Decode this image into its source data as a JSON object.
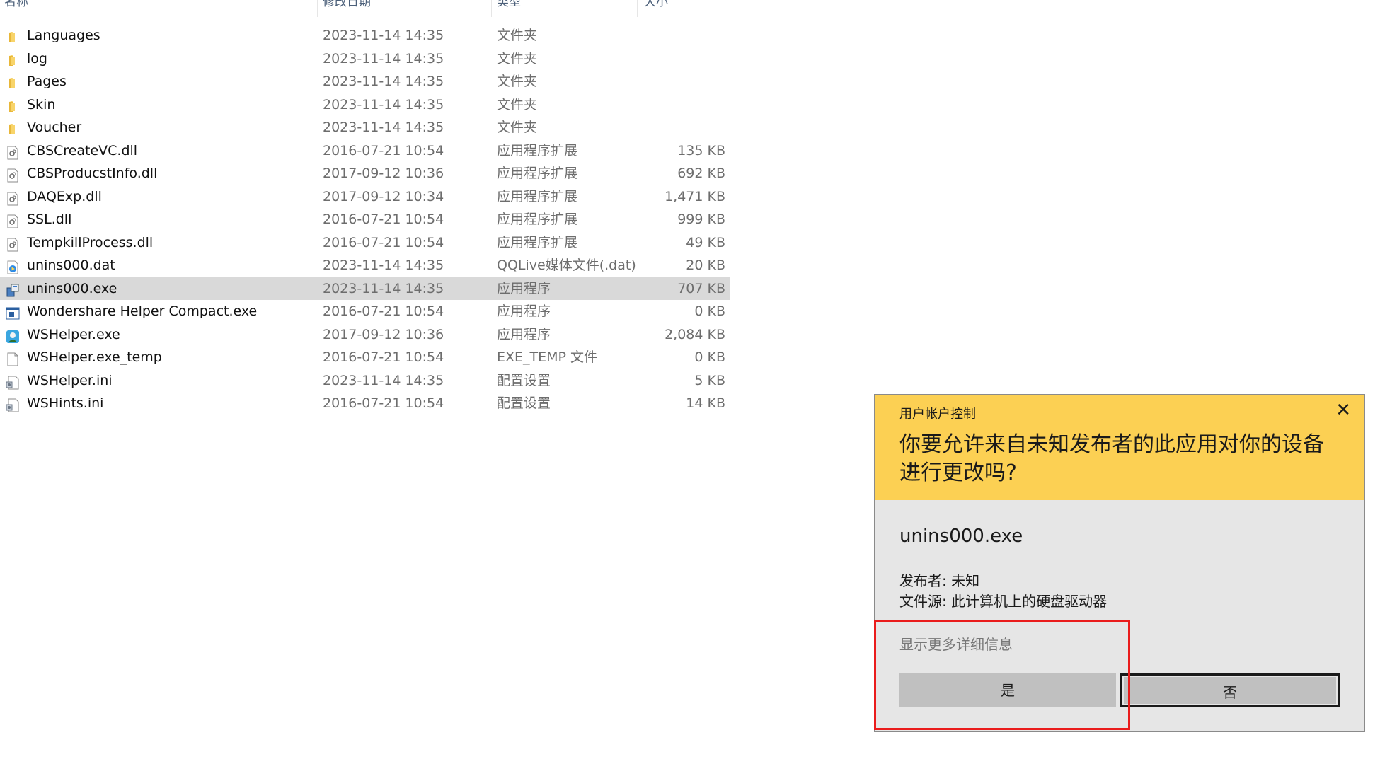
{
  "columns": {
    "name": "名称",
    "date": "修改日期",
    "type": "类型",
    "size": "大小"
  },
  "files": [
    {
      "icon": "folder-icon",
      "name": "Languages",
      "date": "2023-11-14 14:35",
      "type": "文件夹",
      "size": ""
    },
    {
      "icon": "folder-icon",
      "name": "log",
      "date": "2023-11-14 14:35",
      "type": "文件夹",
      "size": ""
    },
    {
      "icon": "folder-icon",
      "name": "Pages",
      "date": "2023-11-14 14:35",
      "type": "文件夹",
      "size": ""
    },
    {
      "icon": "folder-icon",
      "name": "Skin",
      "date": "2023-11-14 14:35",
      "type": "文件夹",
      "size": ""
    },
    {
      "icon": "folder-icon",
      "name": "Voucher",
      "date": "2023-11-14 14:35",
      "type": "文件夹",
      "size": ""
    },
    {
      "icon": "dll-file-icon",
      "name": "CBSCreateVC.dll",
      "date": "2016-07-21 10:54",
      "type": "应用程序扩展",
      "size": "135 KB"
    },
    {
      "icon": "dll-file-icon",
      "name": "CBSProducstInfo.dll",
      "date": "2017-09-12 10:36",
      "type": "应用程序扩展",
      "size": "692 KB"
    },
    {
      "icon": "dll-file-icon",
      "name": "DAQExp.dll",
      "date": "2017-09-12 10:34",
      "type": "应用程序扩展",
      "size": "1,471 KB"
    },
    {
      "icon": "dll-file-icon",
      "name": "SSL.dll",
      "date": "2016-07-21 10:54",
      "type": "应用程序扩展",
      "size": "999 KB"
    },
    {
      "icon": "dll-file-icon",
      "name": "TempkillProcess.dll",
      "date": "2016-07-21 10:54",
      "type": "应用程序扩展",
      "size": "49 KB"
    },
    {
      "icon": "media-file-icon",
      "name": "unins000.dat",
      "date": "2023-11-14 14:35",
      "type": "QQLive媒体文件(.dat)",
      "size": "20 KB"
    },
    {
      "icon": "installer-icon",
      "name": "unins000.exe",
      "date": "2023-11-14 14:35",
      "type": "应用程序",
      "size": "707 KB",
      "selected": true
    },
    {
      "icon": "app-window-icon",
      "name": "Wondershare Helper Compact.exe",
      "date": "2016-07-21 10:54",
      "type": "应用程序",
      "size": "0 KB"
    },
    {
      "icon": "wshelper-app-icon",
      "name": "WSHelper.exe",
      "date": "2017-09-12 10:36",
      "type": "应用程序",
      "size": "2,084 KB"
    },
    {
      "icon": "blank-file-icon",
      "name": "WSHelper.exe_temp",
      "date": "2016-07-21 10:54",
      "type": "EXE_TEMP 文件",
      "size": "0 KB"
    },
    {
      "icon": "ini-file-icon",
      "name": "WSHelper.ini",
      "date": "2023-11-14 14:35",
      "type": "配置设置",
      "size": "5 KB"
    },
    {
      "icon": "ini-file-icon",
      "name": "WSHints.ini",
      "date": "2016-07-21 10:54",
      "type": "配置设置",
      "size": "14 KB"
    }
  ],
  "uac": {
    "title": "用户帐户控制",
    "close": "✕",
    "question": "你要允许来自未知发布者的此应用对你的设备进行更改吗?",
    "app_name": "unins000.exe",
    "publisher": "发布者: 未知",
    "origin": "文件源: 此计算机上的硬盘驱动器",
    "more_details": "显示更多详细信息",
    "yes": "是",
    "no": "否"
  },
  "colors": {
    "uac_header": "#fcd053",
    "highlight": "#ea1c1c",
    "selection": "#d9d9d9"
  }
}
